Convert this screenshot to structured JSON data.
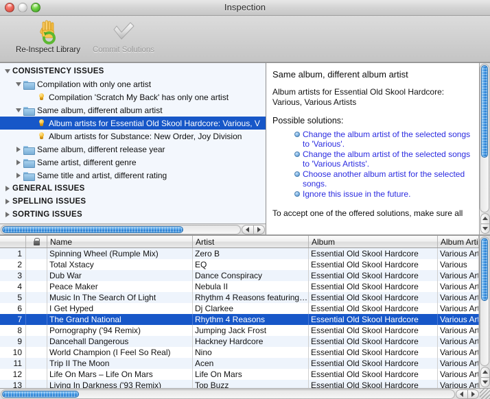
{
  "window": {
    "title": "Inspection",
    "controls": [
      {
        "name": "close-button",
        "icon": "close-light"
      },
      {
        "name": "minimize-button",
        "icon": "minimize-light"
      },
      {
        "name": "zoom-button",
        "icon": "zoom-light"
      }
    ]
  },
  "toolbar": {
    "items": [
      {
        "label": "Re-Inspect Library",
        "icon": "hand-refresh-icon",
        "enabled": true
      },
      {
        "label": "Commit Solutions",
        "icon": "checkmark-icon",
        "enabled": false
      }
    ]
  },
  "tree": {
    "nodes": [
      {
        "label": "CONSISTENCY ISSUES",
        "level": 0,
        "type": "group",
        "expanded": true
      },
      {
        "label": "Compilation with only one artist",
        "level": 1,
        "type": "folder",
        "expanded": true
      },
      {
        "label": "Compilation 'Scratch My Back' has only one artist",
        "level": 2,
        "type": "issue"
      },
      {
        "label": "Same album, different album artist",
        "level": 1,
        "type": "folder",
        "expanded": true
      },
      {
        "label": "Album artists for Essential Old Skool Hardcore: Various, V",
        "level": 2,
        "type": "issue",
        "selected": true
      },
      {
        "label": "Album artists for Substance: New Order, Joy Division",
        "level": 2,
        "type": "issue"
      },
      {
        "label": "Same album, different release year",
        "level": 1,
        "type": "folder",
        "expanded": false
      },
      {
        "label": "Same artist, different genre",
        "level": 1,
        "type": "folder",
        "expanded": false
      },
      {
        "label": "Same title and artist, different rating",
        "level": 1,
        "type": "folder",
        "expanded": false
      },
      {
        "label": "GENERAL ISSUES",
        "level": 0,
        "type": "group",
        "expanded": false
      },
      {
        "label": "SPELLING ISSUES",
        "level": 0,
        "type": "group",
        "expanded": false
      },
      {
        "label": "SORTING ISSUES",
        "level": 0,
        "type": "group",
        "expanded": false
      }
    ]
  },
  "detail": {
    "title": "Same album, different album artist",
    "subtitle": "Album artists for Essential Old Skool Hardcore: Various, Various Artists",
    "solutions_header": "Possible solutions:",
    "solutions": [
      "Change the album artist of the selected songs to 'Various'.",
      "Change the album artist of the selected songs to 'Various Artists'.",
      "Choose another album artist for the selected songs.",
      "Ignore this issue in the future."
    ],
    "footer": "To accept one of the offered solutions, make sure all"
  },
  "table": {
    "columns": [
      {
        "key": "num",
        "label": ""
      },
      {
        "key": "lock",
        "label": "",
        "icon": "lock-icon"
      },
      {
        "key": "name",
        "label": "Name"
      },
      {
        "key": "artist",
        "label": "Artist"
      },
      {
        "key": "album",
        "label": "Album"
      },
      {
        "key": "album_artist",
        "label": "Album Artis"
      }
    ],
    "rows": [
      {
        "num": "1",
        "name": "Spinning Wheel (Rumple Mix)",
        "artist": "Zero B",
        "album": "Essential Old Skool Hardcore",
        "album_artist": "Various Arti"
      },
      {
        "num": "2",
        "name": "Total Xstacy",
        "artist": "EQ",
        "album": "Essential Old Skool Hardcore",
        "album_artist": "Various"
      },
      {
        "num": "3",
        "name": "Dub War",
        "artist": "Dance Conspiracy",
        "album": "Essential Old Skool Hardcore",
        "album_artist": "Various Arti"
      },
      {
        "num": "4",
        "name": "Peace Maker",
        "artist": "Nebula II",
        "album": "Essential Old Skool Hardcore",
        "album_artist": "Various Arti"
      },
      {
        "num": "5",
        "name": "Music In The Search Of Light",
        "artist": "Rhythm 4 Reasons featuring…",
        "album": "Essential Old Skool Hardcore",
        "album_artist": "Various Arti"
      },
      {
        "num": "6",
        "name": "I Get Hyped",
        "artist": "Dj Clarkee",
        "album": "Essential Old Skool Hardcore",
        "album_artist": "Various Arti"
      },
      {
        "num": "7",
        "name": "The Grand National",
        "artist": "Rhythm 4 Reasons",
        "album": "Essential Old Skool Hardcore",
        "album_artist": "Various Arti",
        "selected": true
      },
      {
        "num": "8",
        "name": "Pornography ('94 Remix)",
        "artist": "Jumping Jack Frost",
        "album": "Essential Old Skool Hardcore",
        "album_artist": "Various Arti"
      },
      {
        "num": "9",
        "name": "Dancehall Dangerous",
        "artist": "Hackney Hardcore",
        "album": "Essential Old Skool Hardcore",
        "album_artist": "Various Arti"
      },
      {
        "num": "10",
        "name": "World Champion (I Feel So Real)",
        "artist": "Nino",
        "album": "Essential Old Skool Hardcore",
        "album_artist": "Various Arti"
      },
      {
        "num": "11",
        "name": "Trip II The Moon",
        "artist": "Acen",
        "album": "Essential Old Skool Hardcore",
        "album_artist": "Various Arti"
      },
      {
        "num": "12",
        "name": "Life On Mars – Life On Mars",
        "artist": "Life On Mars",
        "album": "Essential Old Skool Hardcore",
        "album_artist": "Various Arti"
      },
      {
        "num": "13",
        "name": "Living In Darkness ('93 Remix)",
        "artist": "Top Buzz",
        "album": "Essential Old Skool Hardcore",
        "album_artist": "Various Arti"
      }
    ]
  },
  "colors": {
    "selection": "#1757c8",
    "link": "#2b2be0",
    "tree_bg": "#f3f7fd",
    "row_alt": "#eef4fc"
  }
}
